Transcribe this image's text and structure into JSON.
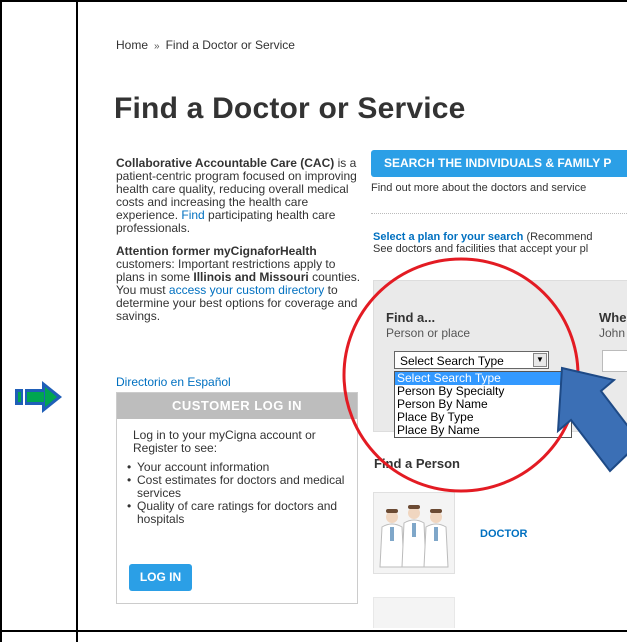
{
  "breadcrumb": {
    "home": "Home",
    "separator": "»",
    "current": "Find a Doctor or Service"
  },
  "page_title": "Find a Doctor or Service",
  "cac": {
    "title": "Collaborative Accountable Care (CAC)",
    "text": " is a patient-centric program focused on improving health care quality, reducing overall medical costs and increasing the health care experience. ",
    "link": "Find",
    "text_after": " participating health care professionals."
  },
  "attention": {
    "title": "Attention former myCignaforHealth",
    "text1": " customers: Important restrictions apply to plans in some ",
    "bold": "Illinois and Missouri",
    "text2": " counties. You must ",
    "link": "access your custom directory",
    "text3": " to determine your best options for coverage and savings."
  },
  "directorio": "Directorio en Español",
  "login": {
    "header": "CUSTOMER LOG IN",
    "intro": "Log in to your myCigna account or Register to see:",
    "items": [
      "Your account information",
      "Cost estimates for doctors and medical services",
      "Quality of care ratings for doctors and hospitals"
    ],
    "button": "LOG IN"
  },
  "search_button": "SEARCH THE INDIVIDUALS & FAMILY P",
  "find_out": "Find out more about the doctors and service",
  "select_plan": {
    "link": "Select a plan for your search",
    "text": " (Recommend",
    "line2": "See doctors and facilities that accept your pl"
  },
  "find_a": {
    "label": "Find a...",
    "sub": "Person or place"
  },
  "where": {
    "label": "Whe",
    "sub": "John"
  },
  "select": {
    "value": "Select Search Type",
    "options": [
      "Select Search Type",
      "Person By Specialty",
      "Person By Name",
      "Place By Type",
      "Place By Name"
    ]
  },
  "find_person": "Find a Person",
  "doctor_link": "DOCTOR",
  "colors": {
    "accent": "#2b9fe6",
    "link": "#0070c0",
    "annotation_circle": "#e31b23",
    "pointer_arrow": "#3b6fb5",
    "green_arrow": "#00a650"
  }
}
